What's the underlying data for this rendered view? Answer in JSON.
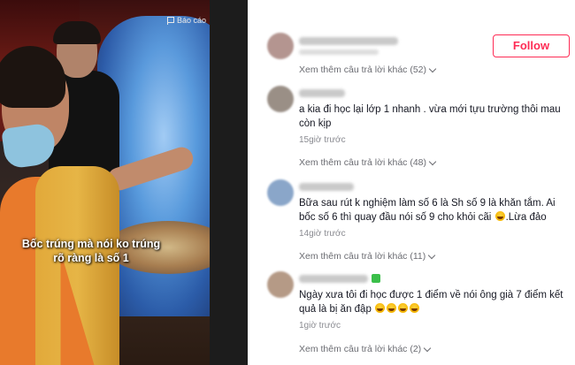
{
  "video": {
    "report_label": "Báo cáo",
    "caption": "Bốc trúng mà nói ko trúng  rõ ràng là số 1"
  },
  "follow_button": {
    "label": "Follow",
    "color": "#fe2c55"
  },
  "comments": [
    {
      "avatar_color": "#b49590",
      "more_label": "Xem thêm câu trả lời khác (52)"
    },
    {
      "avatar_color": "#9a8f86",
      "text": "a kia đi học lại lớp 1 nhanh . vừa mới tựu trường thôi mau còn kịp",
      "time": "15giờ trước",
      "more_label": "Xem thêm câu trả lời khác (48)"
    },
    {
      "avatar_color": "#8aa6c9",
      "text": "Bữa sau rút k nghiệm làm số 6 là Sh số 9 là khăn tắm. Ai bốc số 6 thì quay đầu nói số 9 cho khỏi cãi",
      "text_end": ".Lừa đảo",
      "time": "14giờ trước",
      "more_label": "Xem thêm câu trả lời khác (11)"
    },
    {
      "avatar_color": "#b59a86",
      "text": "Ngày xưa tôi đi học được 1 điểm về nói ông già 7 điểm kết quả là bị ăn đập",
      "time": "1giờ trước",
      "more_label": "Xem thêm câu trả lời khác (2)"
    }
  ]
}
